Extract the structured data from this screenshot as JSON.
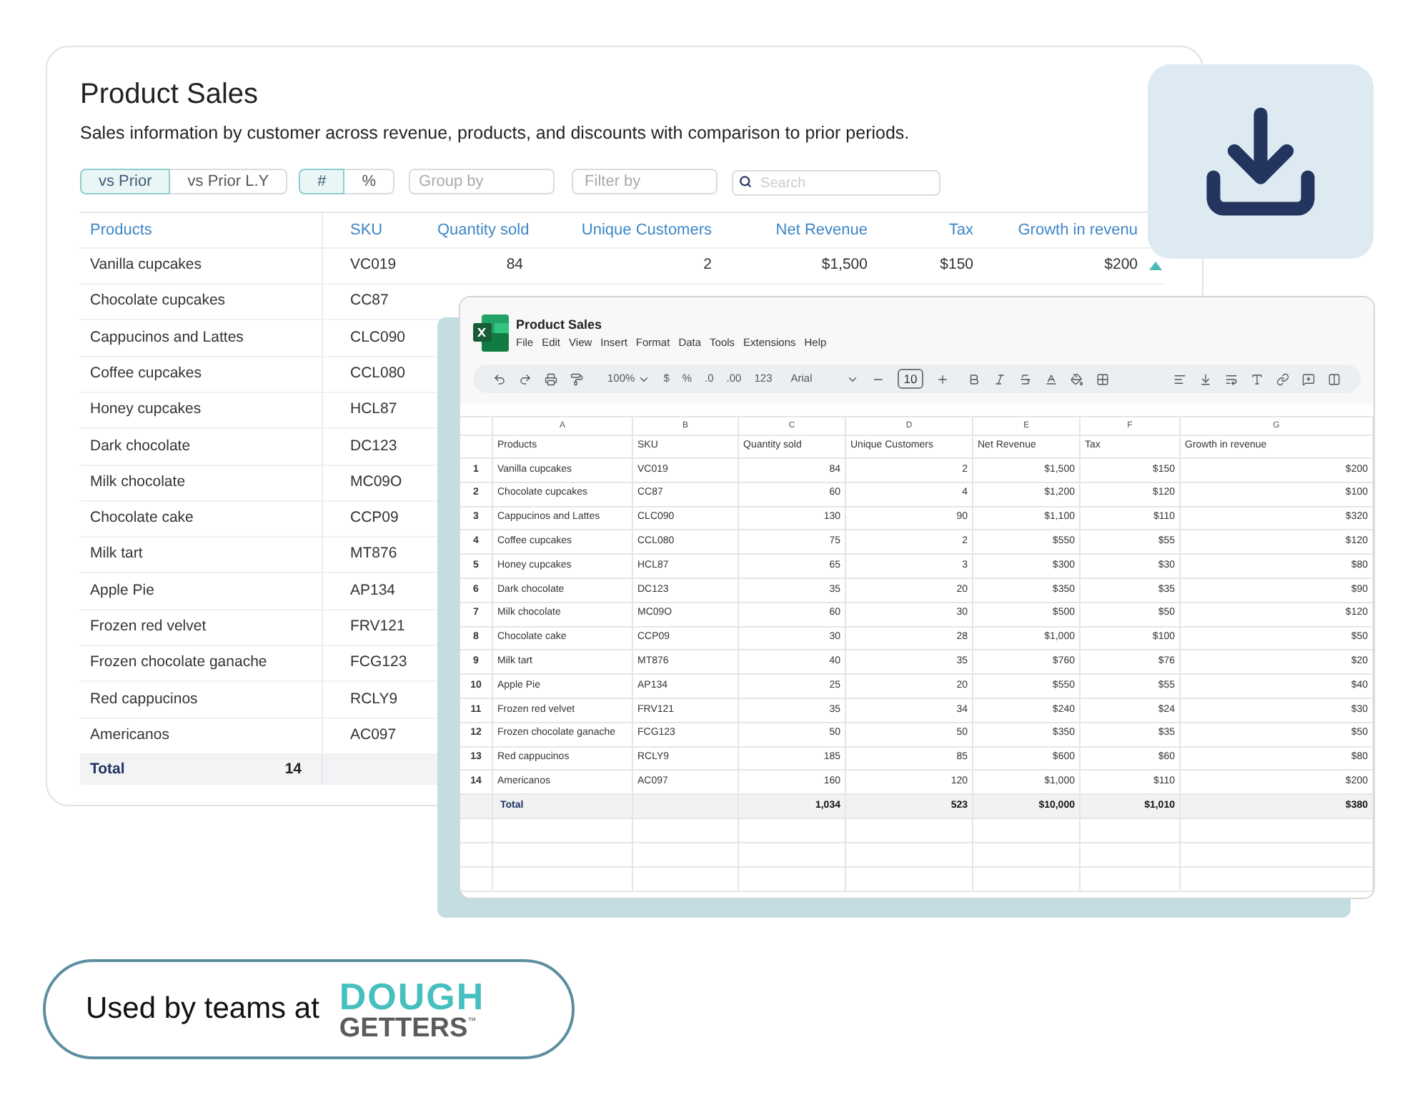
{
  "back_card": {
    "title": "Product Sales",
    "subtitle": "Sales information by customer across revenue, products, and discounts with comparison to prior periods.",
    "comparison_toggle": [
      {
        "label": "vs Prior",
        "selected": true
      },
      {
        "label": "vs Prior L.Y",
        "selected": false
      }
    ],
    "unit_toggle": [
      {
        "label": "#",
        "selected": true
      },
      {
        "label": "%",
        "selected": false
      }
    ],
    "group_by": {
      "placeholder": "Group by"
    },
    "filter_by": {
      "placeholder": "Filter by"
    },
    "search": {
      "placeholder": "Search"
    },
    "table": {
      "columns": [
        "Products",
        "SKU",
        "Quantity sold",
        "Unique Customers",
        "Net Revenue",
        "Tax",
        "Growth in revenu"
      ],
      "rows": [
        {
          "cells": [
            "Vanilla cupcakes",
            "VC019",
            "84",
            "2",
            "$1,500",
            "$150",
            "$200"
          ],
          "trend_up": true
        },
        {
          "cells": [
            "Chocolate cupcakes",
            "CC87"
          ]
        },
        {
          "cells": [
            "Cappucinos and Lattes",
            "CLC090"
          ]
        },
        {
          "cells": [
            "Coffee cupcakes",
            "CCL080"
          ]
        },
        {
          "cells": [
            "Honey cupcakes",
            "HCL87"
          ]
        },
        {
          "cells": [
            "Dark chocolate",
            "DC123"
          ]
        },
        {
          "cells": [
            "Milk chocolate",
            "MC09O"
          ]
        },
        {
          "cells": [
            "Chocolate cake",
            "CCP09"
          ]
        },
        {
          "cells": [
            "Milk tart",
            "MT876"
          ]
        },
        {
          "cells": [
            "Apple Pie",
            "AP134"
          ]
        },
        {
          "cells": [
            "Frozen red velvet",
            "FRV121"
          ]
        },
        {
          "cells": [
            "Frozen chocolate ganache",
            "FCG123"
          ]
        },
        {
          "cells": [
            "Red cappucinos",
            "RCLY9"
          ]
        },
        {
          "cells": [
            "Americanos",
            "AC097"
          ]
        }
      ],
      "total": {
        "label": "Total",
        "count": "14"
      }
    }
  },
  "spreadsheet": {
    "title": "Product Sales",
    "menu": [
      "File",
      "Edit",
      "View",
      "Insert",
      "Format",
      "Data",
      "Tools",
      "Extensions",
      "Help"
    ],
    "toolbar": {
      "zoom": "100%",
      "currency": "$",
      "percent": "%",
      "decrease_decimals": ".0",
      "increase_decimals": ".00",
      "number_format": "123",
      "font": "Arial",
      "font_size": "10"
    },
    "column_letters": [
      "A",
      "B",
      "C",
      "D",
      "E",
      "F",
      "G"
    ],
    "header_row": [
      "Products",
      "SKU",
      "Quantity sold",
      "Unique Customers",
      "Net Revenue",
      "Tax",
      "Growth in revenue"
    ],
    "rows": [
      {
        "number": "1",
        "cells": [
          "Vanilla cupcakes",
          "VC019",
          "84",
          "2",
          "$1,500",
          "$150",
          "$200"
        ]
      },
      {
        "number": "2",
        "cells": [
          "Chocolate cupcakes",
          "CC87",
          "60",
          "4",
          "$1,200",
          "$120",
          "$100"
        ]
      },
      {
        "number": "3",
        "cells": [
          "Cappucinos and Lattes",
          "CLC090",
          "130",
          "90",
          "$1,100",
          "$110",
          "$320"
        ]
      },
      {
        "number": "4",
        "cells": [
          "Coffee cupcakes",
          "CCL080",
          "75",
          "2",
          "$550",
          "$55",
          "$120"
        ]
      },
      {
        "number": "5",
        "cells": [
          "Honey cupcakes",
          "HCL87",
          "65",
          "3",
          "$300",
          "$30",
          "$80"
        ]
      },
      {
        "number": "6",
        "cells": [
          "Dark chocolate",
          "DC123",
          "35",
          "20",
          "$350",
          "$35",
          "$90"
        ]
      },
      {
        "number": "7",
        "cells": [
          "Milk chocolate",
          "MC09O",
          "60",
          "30",
          "$500",
          "$50",
          "$120"
        ]
      },
      {
        "number": "8",
        "cells": [
          "Chocolate cake",
          "CCP09",
          "30",
          "28",
          "$1,000",
          "$100",
          "$50"
        ]
      },
      {
        "number": "9",
        "cells": [
          "Milk tart",
          "MT876",
          "40",
          "35",
          "$760",
          "$76",
          "$20"
        ]
      },
      {
        "number": "10",
        "cells": [
          "Apple Pie",
          "AP134",
          "25",
          "20",
          "$550",
          "$55",
          "$40"
        ]
      },
      {
        "number": "11",
        "cells": [
          "Frozen red velvet",
          "FRV121",
          "35",
          "34",
          "$240",
          "$24",
          "$30"
        ]
      },
      {
        "number": "12",
        "cells": [
          "Frozen chocolate ganache",
          "FCG123",
          "50",
          "50",
          "$350",
          "$35",
          "$50"
        ]
      },
      {
        "number": "13",
        "cells": [
          "Red cappucinos",
          "RCLY9",
          "185",
          "85",
          "$600",
          "$60",
          "$80"
        ]
      },
      {
        "number": "14",
        "cells": [
          "Americanos",
          "AC097",
          "160",
          "120",
          "$1,000",
          "$110",
          "$200"
        ]
      }
    ],
    "total": {
      "label": "Total",
      "values": [
        "1,034",
        "523",
        "$10,000",
        "$1,010",
        "$380"
      ]
    }
  },
  "badge": {
    "text": "Used by teams at",
    "logo_top": "DOUGH",
    "logo_bottom": "GETTERS",
    "trademark": "™"
  }
}
